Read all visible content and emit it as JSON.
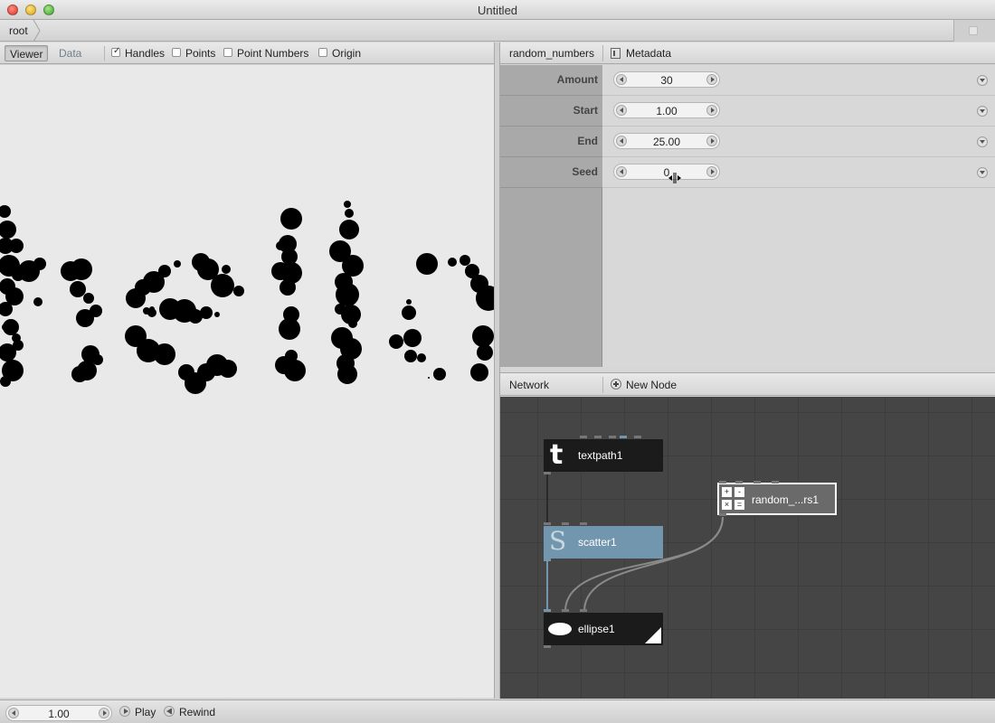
{
  "window": {
    "title": "Untitled"
  },
  "address_bar": {
    "crumb": "root"
  },
  "viewer": {
    "tabs": [
      {
        "label": "Viewer",
        "active": true
      },
      {
        "label": "Data",
        "active": false
      }
    ],
    "options": [
      {
        "label": "Handles",
        "checked": true
      },
      {
        "label": "Points",
        "checked": false
      },
      {
        "label": "Point Numbers",
        "checked": false
      },
      {
        "label": "Origin",
        "checked": false
      }
    ],
    "fill_color": "#000000",
    "background_color": "#e9e9e9"
  },
  "parameters": {
    "node_name": "random_numbers",
    "metadata_label": "Metadata",
    "rows": [
      {
        "label": "Amount",
        "value": "30"
      },
      {
        "label": "Start",
        "value": "1.00"
      },
      {
        "label": "End",
        "value": "25.00"
      },
      {
        "label": "Seed",
        "value": "0"
      }
    ]
  },
  "network": {
    "header_label": "Network",
    "new_node_label": "New Node",
    "nodes": [
      {
        "id": "textpath1",
        "label": "textpath1",
        "icon": "text-t-icon"
      },
      {
        "id": "scatter1",
        "label": "scatter1",
        "icon": "scatter-icon",
        "selected": true,
        "color": "#7296ad"
      },
      {
        "id": "ellipse1",
        "label": "ellipse1",
        "icon": "ellipse-icon",
        "rendered": true
      },
      {
        "id": "random_numbers1",
        "label": "random_...rs1",
        "icon": "math-operators-icon",
        "active": true
      }
    ]
  },
  "timeline": {
    "frame": "1.00",
    "play_label": "Play",
    "rewind_label": "Rewind"
  }
}
